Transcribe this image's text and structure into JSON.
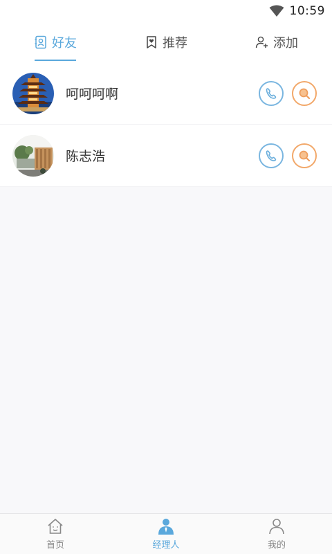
{
  "status_bar": {
    "time": "10:59",
    "wifi_icon": "wifi-icon"
  },
  "tabs": [
    {
      "label": "好友",
      "icon": "contacts-book-icon",
      "active": true
    },
    {
      "label": "推荐",
      "icon": "bookmark-heart-icon",
      "active": false
    },
    {
      "label": "添加",
      "icon": "add-user-icon",
      "active": false
    }
  ],
  "friends": [
    {
      "name": "呵呵呵啊",
      "avatar": "pagoda-photo"
    },
    {
      "name": "陈志浩",
      "avatar": "storefront-photo"
    }
  ],
  "bottom_nav": [
    {
      "label": "首页",
      "icon": "home-icon",
      "active": false
    },
    {
      "label": "经理人",
      "icon": "manager-icon",
      "active": true
    },
    {
      "label": "我的",
      "icon": "profile-icon",
      "active": false
    }
  ],
  "colors": {
    "accent": "#5aa8dc",
    "call": "#7ab6e0",
    "search": "#f2a86a"
  }
}
